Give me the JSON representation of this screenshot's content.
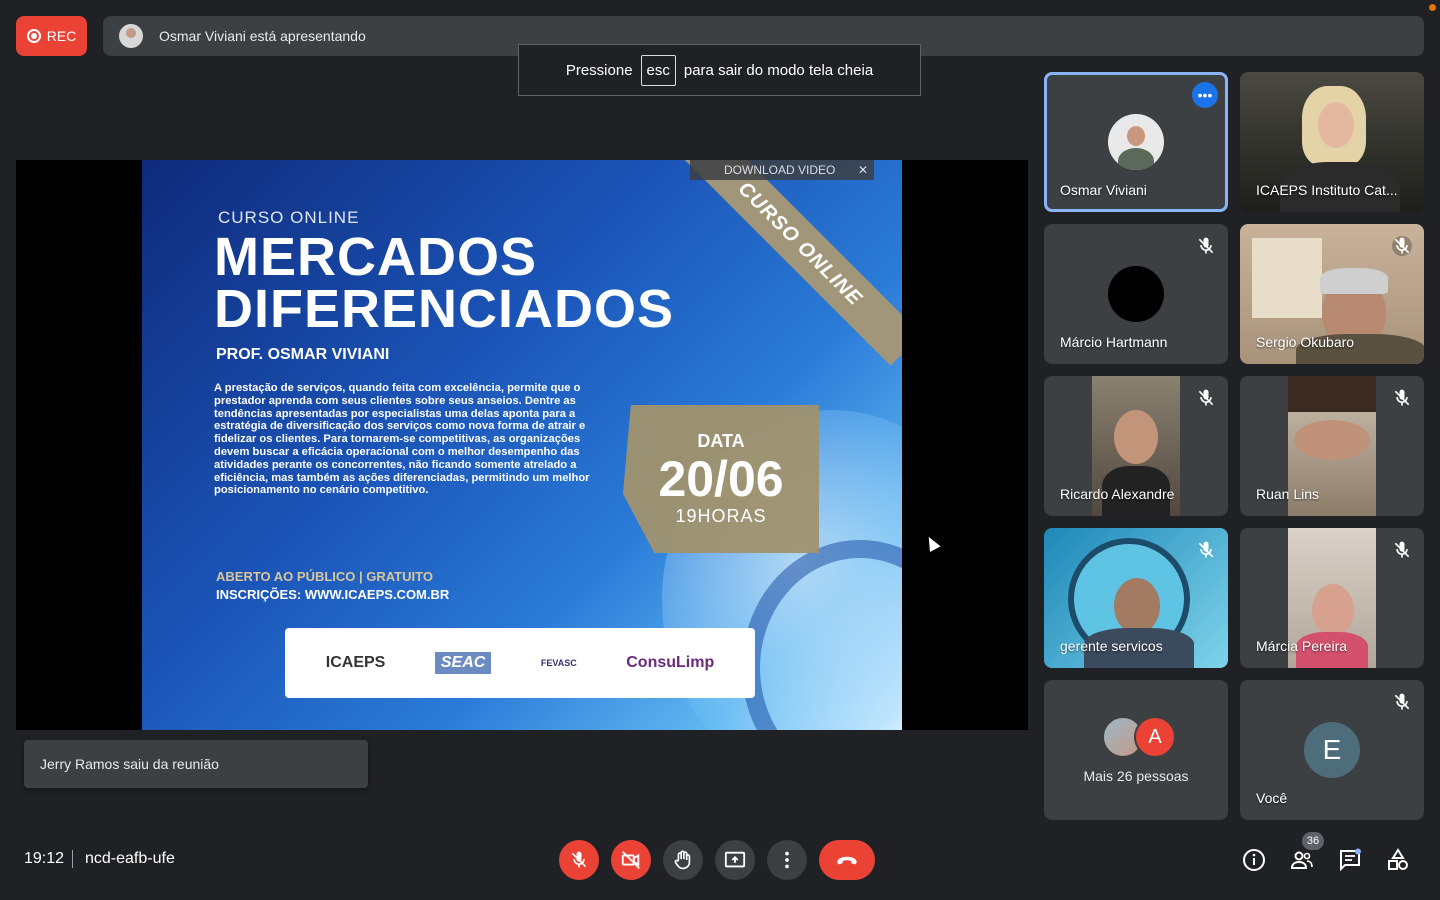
{
  "top": {
    "rec_label": "REC",
    "presenter_text": "Osmar Viviani está apresentando",
    "esc_toast": {
      "before": "Pressione",
      "key": "esc",
      "after": "para sair do modo tela cheia"
    }
  },
  "slide": {
    "download_label": "DOWNLOAD VIDEO",
    "close_glyph": "✕",
    "ribbon": "CURSO ONLINE",
    "subtitle": "CURSO ONLINE",
    "title_line1": "MERCADOS",
    "title_line2": "DIFERENCIADOS",
    "professor": "PROF. OSMAR VIVIANI",
    "body": "A prestação de serviços, quando feita com excelência, permite que o prestador aprenda com seus clientes sobre seus anseios. Dentre as tendências apresentadas por especialistas uma delas aponta para a estratégia de diversificação dos serviços como nova forma de atrair e fidelizar os clientes. Para tornarem-se competitivas, as organizações devem buscar a eficácia operacional com o melhor desempenho das atividades perante os concorrentes, não ficando somente atrelado a eficiência, mas também as ações diferenciadas, permitindo um melhor posicionamento no cenário competitivo.",
    "open": "ABERTO AO PÚBLICO | GRATUITO",
    "registration": "INSCRIÇÕES: WWW.ICAEPS.COM.BR",
    "date_label": "DATA",
    "date_value": "20/06",
    "date_time": "19HORAS",
    "logos": [
      "ICAEPS",
      "SEAC",
      "FEVASC",
      "ConsuLimp"
    ]
  },
  "toast": {
    "leave_message": "Jerry Ramos saiu da reunião"
  },
  "participants": [
    {
      "name": "Osmar Viviani"
    },
    {
      "name": "ICAEPS Instituto Cat..."
    },
    {
      "name": "Márcio Hartmann"
    },
    {
      "name": "Sergio Okubaro"
    },
    {
      "name": "Ricardo Alexandre"
    },
    {
      "name": "Ruan Lins"
    },
    {
      "name": "gerente servicos"
    },
    {
      "name": "Márcia Pereira"
    },
    {
      "name": "Mais 26 pessoas",
      "avatar_letter": "A"
    },
    {
      "name": "Você",
      "avatar_letter": "E"
    }
  ],
  "bottom": {
    "time": "19:12",
    "meeting_code": "ncd-eafb-ufe",
    "people_count": "36"
  },
  "colors": {
    "accent_blue": "#8ab4f8",
    "danger_red": "#ea4335",
    "surface": "#3c4043",
    "background": "#202124"
  }
}
